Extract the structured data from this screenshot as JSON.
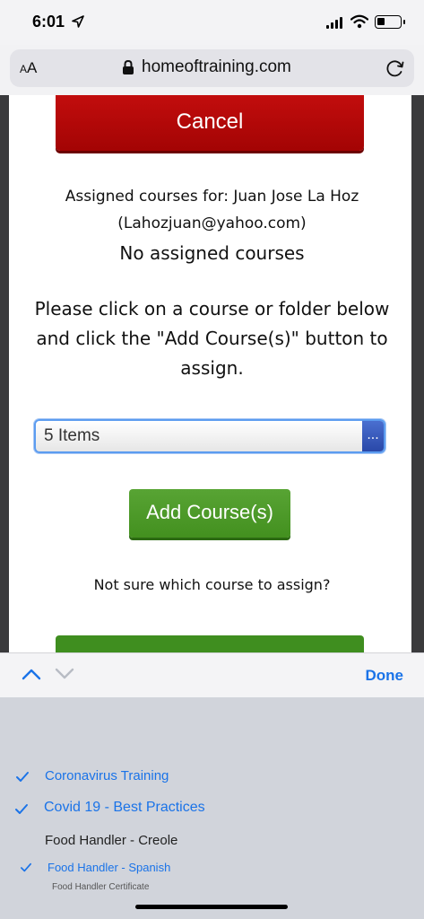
{
  "status_bar": {
    "time": "6:01",
    "icons": [
      "location-arrow-icon",
      "signal-icon",
      "wifi-icon",
      "battery-icon"
    ]
  },
  "browser": {
    "text_size_label": "AA",
    "url": "homeoftraining.com"
  },
  "page": {
    "cancel_label": "Cancel",
    "assigned_for": "Assigned courses for: Juan Jose La Hoz",
    "email": "(Lahozjuan@yahoo.com)",
    "no_courses": "No assigned courses",
    "instructions": "Please click on a course or folder below and click the \"Add Course(s)\" button to assign.",
    "select_value": "5 Items",
    "select_button": "...",
    "add_label": "Add Course(s)",
    "not_sure": "Not sure which course to assign?",
    "colors": {
      "cancel": "#b30808",
      "add": "#4f9a2a",
      "accent": "#1a73e8"
    }
  },
  "picker": {
    "done_label": "Done",
    "items": [
      {
        "label": "Coronavirus Training",
        "checked": true
      },
      {
        "label": "Covid 19 - Best Practices",
        "checked": true
      },
      {
        "label": "Food Handler - Creole",
        "checked": false
      },
      {
        "label": "Food Handler - Spanish",
        "checked": true
      },
      {
        "label": "Food Handler Certificate",
        "checked": false
      }
    ]
  }
}
